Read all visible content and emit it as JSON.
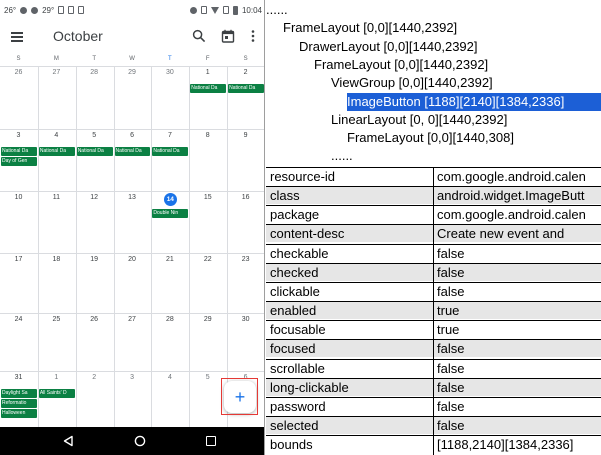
{
  "device": {
    "status_left": "26°",
    "status_left2": "29°",
    "time": "10:04",
    "month_title": "October",
    "weekdays": [
      {
        "label": "S",
        "today": false
      },
      {
        "label": "M",
        "today": false
      },
      {
        "label": "T",
        "today": false
      },
      {
        "label": "W",
        "today": false
      },
      {
        "label": "T",
        "today": true
      },
      {
        "label": "F",
        "today": false
      },
      {
        "label": "S",
        "today": false
      }
    ],
    "weeks": [
      [
        "26",
        "27",
        "28",
        "29",
        "30",
        "1",
        "2"
      ],
      [
        "3",
        "4",
        "5",
        "6",
        "7",
        "8",
        "9"
      ],
      [
        "10",
        "11",
        "12",
        "13",
        "14",
        "15",
        "16"
      ],
      [
        "17",
        "18",
        "19",
        "20",
        "21",
        "22",
        "23"
      ],
      [
        "24",
        "25",
        "26",
        "27",
        "28",
        "29",
        "30"
      ],
      [
        "31",
        "1",
        "2",
        "3",
        "4",
        "5",
        "6"
      ]
    ],
    "today_date": "14",
    "events": [
      {
        "week": 0,
        "day": 5,
        "line": 0,
        "span": 1,
        "text": "National Da"
      },
      {
        "week": 0,
        "day": 6,
        "line": 0,
        "span": 1,
        "text": "National Da"
      },
      {
        "week": 1,
        "day": 0,
        "line": 0,
        "span": 1,
        "text": "National Da"
      },
      {
        "week": 1,
        "day": 1,
        "line": 0,
        "span": 1,
        "text": "National Da"
      },
      {
        "week": 1,
        "day": 2,
        "line": 0,
        "span": 1,
        "text": "National Da"
      },
      {
        "week": 1,
        "day": 3,
        "line": 0,
        "span": 1,
        "text": "National Da"
      },
      {
        "week": 1,
        "day": 4,
        "line": 0,
        "span": 1,
        "text": "National Da"
      },
      {
        "week": 1,
        "day": 0,
        "line": 1,
        "span": 1,
        "text": "Day of Gen"
      },
      {
        "week": 2,
        "day": 4,
        "line": 0,
        "span": 1,
        "text": "Double Nin"
      },
      {
        "week": 5,
        "day": 0,
        "line": 0,
        "span": 1,
        "text": "Daylight Sa"
      },
      {
        "week": 5,
        "day": 1,
        "line": 0,
        "span": 1,
        "text": "All Saints' D"
      },
      {
        "week": 5,
        "day": 0,
        "line": 1,
        "span": 1,
        "text": "Reformatio"
      },
      {
        "week": 5,
        "day": 0,
        "line": 2,
        "span": 1,
        "text": "Halloween"
      }
    ],
    "fab_label": "+",
    "colors": {
      "event": "#0b8043",
      "accent": "#1a73e8",
      "highlight": "#e53935"
    },
    "icons": {
      "menu": "menu-icon",
      "search": "search-icon",
      "today": "calendar-today-icon",
      "overflow": "more-vert-icon",
      "back": "back-icon",
      "home": "home-icon",
      "recents": "recents-icon"
    }
  },
  "hierarchy": {
    "nodes": [
      {
        "text": "......",
        "level": 0,
        "selected": false
      },
      {
        "text": "FrameLayout [0,0][1440,2392]",
        "level": 1,
        "selected": false
      },
      {
        "text": "DrawerLayout [0,0][1440,2392]",
        "level": 2,
        "selected": false
      },
      {
        "text": "FrameLayout [0,0][1440,2392]",
        "level": 3,
        "selected": false
      },
      {
        "text": "ViewGroup [0,0][1440,2392]",
        "level": 4,
        "selected": false
      },
      {
        "text": "ImageButton [1188][2140][1384,2336]",
        "level": 5,
        "selected": true
      },
      {
        "text": "LinearLayout [0, 0][1440,2392]",
        "level": 4,
        "selected": false
      },
      {
        "text": "FrameLayout [0,0][1440,308]",
        "level": 5,
        "selected": false
      },
      {
        "text": "......",
        "level": 4,
        "selected": false
      }
    ],
    "selection_color": "#1c5fd6"
  },
  "properties": [
    {
      "key": "resource-id",
      "value": "com.google.android.calen"
    },
    {
      "key": "class",
      "value": "android.widget.ImageButt"
    },
    {
      "key": "package",
      "value": "com.google.android.calen"
    },
    {
      "key": "content-desc",
      "value": "Create new event and"
    },
    {
      "key": "checkable",
      "value": "false"
    },
    {
      "key": "checked",
      "value": "false"
    },
    {
      "key": "clickable",
      "value": "false"
    },
    {
      "key": "enabled",
      "value": "true"
    },
    {
      "key": "focusable",
      "value": "true"
    },
    {
      "key": "focused",
      "value": "false"
    },
    {
      "key": "scrollable",
      "value": "false"
    },
    {
      "key": "long-clickable",
      "value": "false"
    },
    {
      "key": "password",
      "value": "false"
    },
    {
      "key": "selected",
      "value": "false"
    },
    {
      "key": "bounds",
      "value": "[1188,2140][1384,2336]"
    }
  ]
}
